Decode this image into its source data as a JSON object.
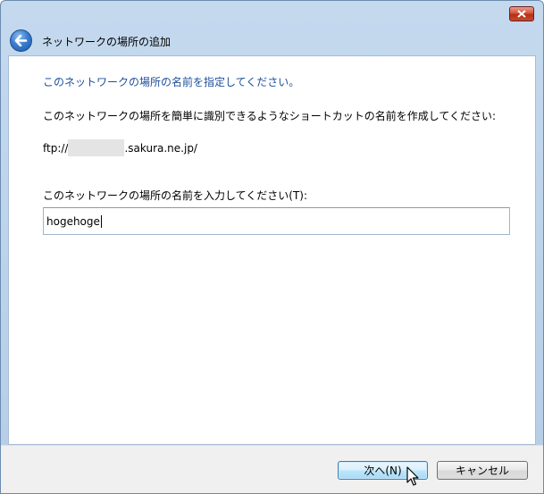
{
  "window": {
    "close_label": "✕"
  },
  "header": {
    "title": "ネットワークの場所の追加"
  },
  "content": {
    "heading": "このネットワークの場所の名前を指定してください。",
    "description": "このネットワークの場所を簡単に識別できるようなショートカットの名前を作成してください:",
    "url_prefix": "ftp://",
    "url_suffix": ".sakura.ne.jp/",
    "name_label": "このネットワークの場所の名前を入力してください(T):",
    "name_value": "hogehoge"
  },
  "footer": {
    "next_label": "次へ(N)",
    "cancel_label": "キャンセル"
  },
  "colors": {
    "accent_text": "#1e4f9a",
    "close_red": "#c64a2e",
    "frame": "#b6cde6"
  }
}
